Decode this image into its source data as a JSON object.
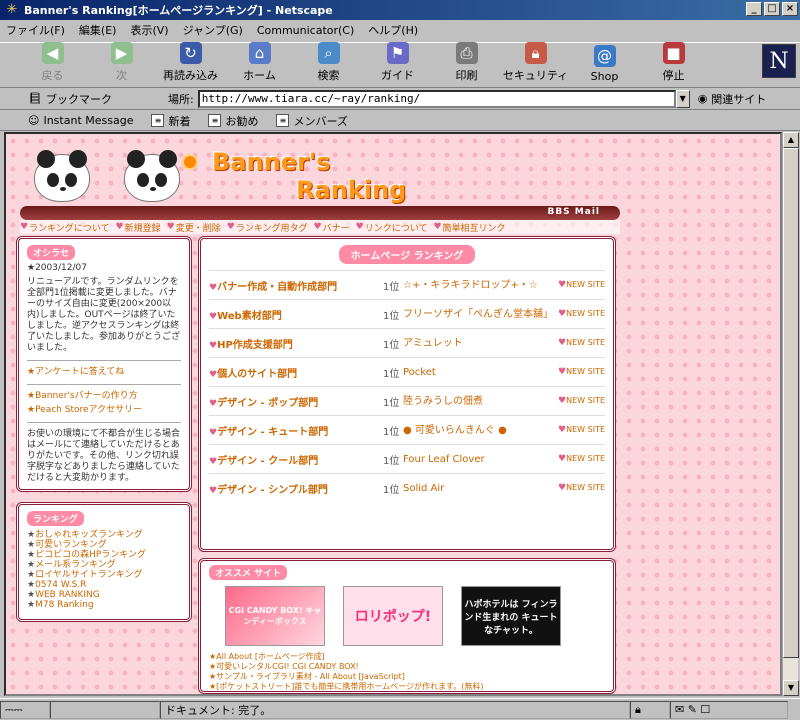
{
  "window": {
    "title": "Banner's Ranking[ホームページランキング] - Netscape"
  },
  "menu": [
    "ファイル(F)",
    "編集(E)",
    "表示(V)",
    "ジャンプ(G)",
    "Communicator(C)",
    "ヘルプ(H)"
  ],
  "toolbar": [
    "戻る",
    "次",
    "再読み込み",
    "ホーム",
    "検索",
    "ガイド",
    "印刷",
    "セキュリティ",
    "Shop",
    "停止"
  ],
  "location": {
    "bookmark": "ブックマーク",
    "label": "場所:",
    "url": "http://www.tiara.cc/~ray/ranking/",
    "related": "関連サイト"
  },
  "personal": [
    "Instant Message",
    "新着",
    "お勧め",
    "メンバーズ"
  ],
  "status": {
    "text": "ドキュメント: 完了。"
  },
  "page": {
    "logo": {
      "line1": "Banner's",
      "line2": "Ranking",
      "sublinks": "BBS  Mail"
    },
    "nav": [
      "ランキングについて",
      "新規登録",
      "変更・削除",
      "ランキング用タグ",
      "バナー",
      "リンクについて",
      "簡単相互リンク"
    ],
    "info": {
      "heading": "オシラセ",
      "date": "★2003/12/07",
      "text": "リニューアルです。ランダムリンクを全部門1位掲載に変更しました。バナーのサイズ自由に変更(200×200以内)しました。OUTページは終了いたしました。逆アクセスランキングは終了いたしました。参加ありがとうございました。",
      "enquete": "★アンケートに答えてね",
      "link1": "★Banner'sバナーの作り方",
      "link2": "★Peach Storeアクセサリー",
      "notice": "お使いの環境にて不都合が生じる場合はメールにて連絡していただけるとありがたいです。その他、リンク切れ誤字脱字などありましたら連絡していただけると大変助かります。"
    },
    "ranking": {
      "heading": "ランキング",
      "items": [
        "おしゃれキッズランキング",
        "可愛いランキング",
        "ピコピコの森HPランキング",
        "メール系ランキング",
        "ロイヤルサイトランキング",
        "0574 W.S.R",
        "WEB RANKING",
        "M78 Ranking"
      ]
    },
    "main": {
      "heading": "ホームページ ランキング",
      "rows": [
        {
          "cat": "バナー作成・自動作成部門",
          "pos": "1位",
          "site": "☆+・キラキラドロップ+・☆",
          "new": "NEW SITE"
        },
        {
          "cat": "Web素材部門",
          "pos": "1位",
          "site": "フリーソザイ「ぺんぎん堂本舗」",
          "new": "NEW SITE"
        },
        {
          "cat": "HP作成支援部門",
          "pos": "1位",
          "site": "アミュレット",
          "new": "NEW SITE"
        },
        {
          "cat": "個人のサイト部門",
          "pos": "1位",
          "site": "Pocket",
          "new": "NEW SITE"
        },
        {
          "cat": "デザイン - ポップ部門",
          "pos": "1位",
          "site": "陸うみうしの佃煮",
          "new": "NEW SITE"
        },
        {
          "cat": "デザイン - キュート部門",
          "pos": "1位",
          "site": "● 可愛いらんきんぐ ●",
          "new": "NEW SITE"
        },
        {
          "cat": "デザイン - クール部門",
          "pos": "1位",
          "site": "Four Leaf Clover",
          "new": "NEW SITE"
        },
        {
          "cat": "デザイン - シンプル部門",
          "pos": "1位",
          "site": "Solid  Air",
          "new": "NEW SITE"
        }
      ]
    },
    "osusume": {
      "heading": "オススメ サイト",
      "banners": [
        "CGI CANDY BOX! キャンディーボックス",
        "ロリポップ!",
        "ハポホテルは フィンランド生まれの キュートなチャット。"
      ],
      "links": [
        "★All About [ホームページ作成]",
        "★可愛いレンタルCGI! CGI CANDY BOX!",
        "★サンプル・ライブラリ素材 - All About [JavaScript]",
        "★[ポケットストリート]誰でも簡単に携帯用ホームページが作れます。(無料)"
      ]
    }
  }
}
